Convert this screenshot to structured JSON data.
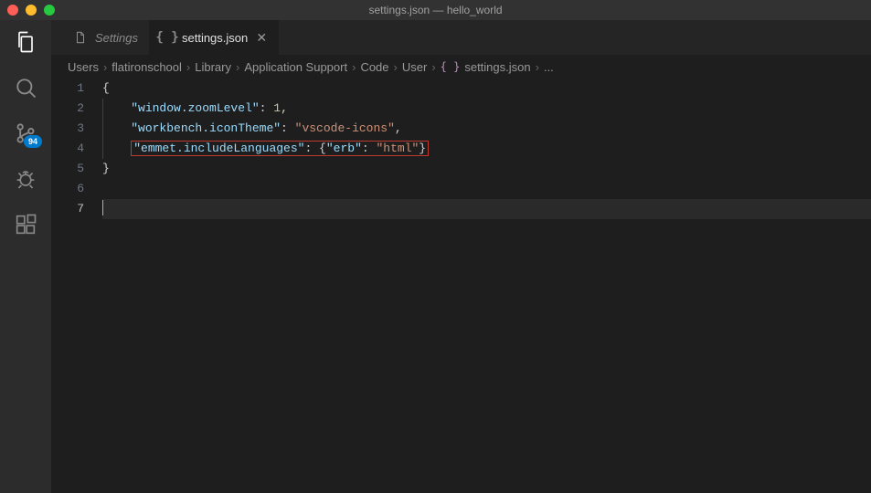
{
  "titlebar": {
    "title": "settings.json — hello_world"
  },
  "activitybar": {
    "scm_badge": "94"
  },
  "tabs": {
    "items": [
      {
        "label": "Settings",
        "icon": "file-icon",
        "active": false
      },
      {
        "label": "settings.json",
        "icon": "json-braces-icon",
        "active": true
      }
    ]
  },
  "breadcrumbs": {
    "segments": [
      "Users",
      "flatironschool",
      "Library",
      "Application Support",
      "Code",
      "User",
      "settings.json"
    ],
    "ellipsis": "..."
  },
  "code": {
    "line_numbers": [
      "1",
      "2",
      "3",
      "4",
      "5",
      "6",
      "7"
    ],
    "content": [
      {
        "type": "brace_open"
      },
      {
        "type": "kv",
        "key": "\"window.zoomLevel\"",
        "value": "1",
        "value_type": "num",
        "trailing_comma": true
      },
      {
        "type": "kv",
        "key": "\"workbench.iconTheme\"",
        "value": "\"vscode-icons\"",
        "value_type": "str",
        "trailing_comma": true
      },
      {
        "type": "kv_obj_highlight",
        "key": "\"emmet.includeLanguages\"",
        "inner_key": "\"erb\"",
        "inner_val": "\"html\""
      },
      {
        "type": "brace_close"
      },
      {
        "type": "empty"
      },
      {
        "type": "cursor"
      }
    ]
  }
}
